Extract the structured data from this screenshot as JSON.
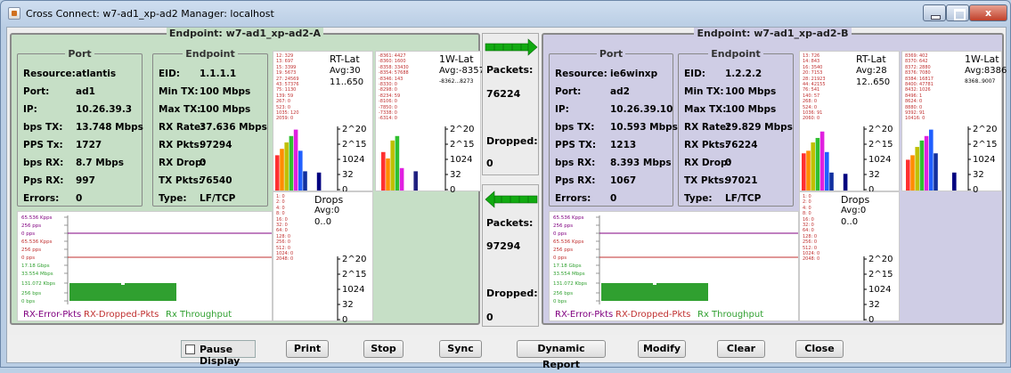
{
  "window": {
    "title": "Cross Connect: w7-ad1_xp-ad2  Manager: localhost",
    "controls": {
      "minimize": "",
      "maximize": "",
      "close": "x"
    }
  },
  "endpoint_a": {
    "title": "Endpoint: w7-ad1_xp-ad2-A",
    "port_box": {
      "title": "Port",
      "rows": [
        {
          "label": "Resource:",
          "value": "atlantis"
        },
        {
          "label": "Port:",
          "value": "ad1"
        },
        {
          "label": "IP:",
          "value": "10.26.39.3"
        },
        {
          "label": "bps TX:",
          "value": "13.748 Mbps"
        },
        {
          "label": "PPS Tx:",
          "value": "1727"
        },
        {
          "label": "bps RX:",
          "value": "8.7 Mbps"
        },
        {
          "label": "Pps RX:",
          "value": "997"
        },
        {
          "label": "Errors:",
          "value": "0"
        }
      ]
    },
    "endpoint_box": {
      "title": "Endpoint",
      "rows": [
        {
          "label": "EID:",
          "value": "1.1.1.1"
        },
        {
          "label": "Min TX:",
          "value": "100 Mbps"
        },
        {
          "label": "Max TX:",
          "value": "100 Mbps"
        },
        {
          "label": "RX Rate:",
          "value": "37.636 Mbps"
        },
        {
          "label": "RX Pkts:",
          "value": "97294"
        },
        {
          "label": "RX Drop:",
          "value": "0"
        },
        {
          "label": "TX Pkts:",
          "value": "76540"
        },
        {
          "label": "Type:",
          "value": "LF/TCP"
        }
      ]
    },
    "rt_lat": {
      "title": "RT-Lat",
      "avg": "Avg:30",
      "range": "11..650",
      "buckets": "12: 329\n13: 697\n15: 3399\n19: 5673\n27: 24569\n43: 57376\n75: 1130\n139: 59\n267: 0\n523: 0\n1035: 120\n2059: 0",
      "yticks": [
        "2^20",
        "2^15",
        "1024",
        "32",
        "0"
      ],
      "bars": [
        0.55,
        0.65,
        0.75,
        0.85,
        0.95,
        0.62,
        0.3,
        0.0,
        0.0,
        0.28,
        0.0
      ],
      "colors": [
        "#ff3030",
        "#ff8c00",
        "#c0c000",
        "#30c030",
        "#e020e0",
        "#2060ff",
        "#1030a0",
        "#606060",
        "#ff4040",
        "#000080",
        "#000080"
      ]
    },
    "ow_lat": {
      "title": "1W-Lat",
      "avg": "Avg:-8357",
      "range": "-8362...8273",
      "buckets": "-8361: 4427\n-8360: 1600\n-8358: 33430\n-8354: 57688\n-8346: 143\n-8330: 0\n-8298: 0\n-8234: 59\n-8106: 0\n-7850: 0\n-7338: 0\n-6314: 0",
      "yticks": [
        "2^20",
        "2^15",
        "1024",
        "32",
        "0"
      ],
      "bars": [
        0.6,
        0.5,
        0.78,
        0.85,
        0.35,
        0.0,
        0.0,
        0.3,
        0.0,
        0.0,
        0.0
      ],
      "colors": [
        "#ff3030",
        "#ff8c00",
        "#c0c000",
        "#30c030",
        "#e020e0",
        "#2060ff",
        "#1030a0",
        "#202080",
        "#000080",
        "#000080",
        "#000080"
      ]
    },
    "drops": {
      "title": "Drops",
      "avg": "Avg:0",
      "range": "0..0",
      "buckets": "1: 0\n2: 0\n4: 0\n8: 0\n16: 0\n32: 0\n64: 0\n128: 0\n256: 0\n512: 0\n1024: 0\n2048: 0",
      "yticks": [
        "2^20",
        "2^15",
        "1024",
        "32",
        "0"
      ]
    },
    "throughput": {
      "ylabels": [
        "65.536 Kpps",
        "256 pps",
        "0 pps",
        "65.536 Kpps",
        "256 pps",
        "0 pps",
        "17.18 Gbps",
        "33.554 Mbps",
        "131.072 Kbps",
        "256 bps",
        "0 bps"
      ],
      "legend": [
        "RX-Error-Pkts",
        "RX-Dropped-Pkts",
        "Rx Throughput"
      ],
      "legend_colors": [
        "#800080",
        "#c03030",
        "#30a030"
      ]
    }
  },
  "endpoint_b": {
    "title": "Endpoint: w7-ad1_xp-ad2-B",
    "port_box": {
      "title": "Port",
      "rows": [
        {
          "label": "Resource:",
          "value": "ie6winxp"
        },
        {
          "label": "Port:",
          "value": "ad2"
        },
        {
          "label": "IP:",
          "value": "10.26.39.10"
        },
        {
          "label": "bps TX:",
          "value": "10.593 Mbps"
        },
        {
          "label": "PPS TX:",
          "value": "1213"
        },
        {
          "label": "bps RX:",
          "value": "8.393 Mbps"
        },
        {
          "label": "Pps RX:",
          "value": "1067"
        },
        {
          "label": "Errors:",
          "value": "0"
        }
      ]
    },
    "endpoint_box": {
      "title": "Endpoint",
      "rows": [
        {
          "label": "EID:",
          "value": "1.2.2.2"
        },
        {
          "label": "Min TX:",
          "value": "100 Mbps"
        },
        {
          "label": "Max TX:",
          "value": "100 Mbps"
        },
        {
          "label": "RX Rate:",
          "value": "29.829 Mbps"
        },
        {
          "label": "RX Pkts:",
          "value": "76224"
        },
        {
          "label": "RX Drop:",
          "value": "0"
        },
        {
          "label": "TX Pkts:",
          "value": "97021"
        },
        {
          "label": "Type:",
          "value": "LF/TCP"
        }
      ]
    },
    "rt_lat": {
      "title": "RT-Lat",
      "avg": "Avg:28",
      "range": "12..650",
      "buckets": "13: 726\n14: 843\n16: 3540\n20: 7153\n28: 21923\n44: 42155\n76: 541\n140: 57\n268: 0\n524: 0\n1036: 91\n2060: 0",
      "yticks": [
        "2^20",
        "2^15",
        "1024",
        "32",
        "0"
      ],
      "bars": [
        0.58,
        0.62,
        0.75,
        0.82,
        0.92,
        0.6,
        0.28,
        0.0,
        0.0,
        0.26,
        0.0
      ],
      "colors": [
        "#ff3030",
        "#ff8c00",
        "#c0c000",
        "#30c030",
        "#e020e0",
        "#2060ff",
        "#1030a0",
        "#606060",
        "#ff4040",
        "#000080",
        "#000080"
      ]
    },
    "ow_lat": {
      "title": "1W-Lat",
      "avg": "Avg:8386",
      "range": "8368..9007",
      "buckets": "8369: 402\n8370: 642\n8372: 2880\n8376: 7080\n8384: 16817\n8400: 47781\n8432: 1026\n8496: 1\n8624: 0\n8880: 0\n9392: 91\n10416: 0",
      "yticks": [
        "2^20",
        "2^15",
        "1024",
        "32",
        "0"
      ],
      "bars": [
        0.48,
        0.55,
        0.68,
        0.78,
        0.85,
        0.95,
        0.58,
        0.0,
        0.0,
        0.0,
        0.28
      ],
      "colors": [
        "#ff3030",
        "#ff8c00",
        "#c0c000",
        "#30c030",
        "#e020e0",
        "#2060ff",
        "#1030a0",
        "#202080",
        "#000080",
        "#000080",
        "#000080"
      ]
    },
    "drops": {
      "title": "Drops",
      "avg": "Avg:0",
      "range": "0..0",
      "buckets": "1: 0\n2: 0\n4: 0\n8: 0\n16: 0\n32: 0\n64: 0\n128: 0\n256: 0\n512: 0\n1024: 0\n2048: 0",
      "yticks": [
        "2^20",
        "2^15",
        "1024",
        "32",
        "0"
      ]
    },
    "throughput": {
      "ylabels": [
        "65.536 Kpps",
        "256 pps",
        "0 pps",
        "65.536 Kpps",
        "256 pps",
        "0 pps",
        "17.18 Gbps",
        "33.554 Mbps",
        "131.072 Kbps",
        "256 bps",
        "0 bps"
      ],
      "legend": [
        "RX-Error-Pkts",
        "RX-Dropped-Pkts",
        "Rx Throughput"
      ],
      "legend_colors": [
        "#800080",
        "#c03030",
        "#30a030"
      ]
    }
  },
  "middle": {
    "top": {
      "packets_label": "Packets:",
      "packets": "76224",
      "dropped_label": "Dropped:",
      "dropped": "0"
    },
    "bottom": {
      "packets_label": "Packets:",
      "packets": "97294",
      "dropped_label": "Dropped:",
      "dropped": "0"
    }
  },
  "buttons": {
    "pause": "Pause Display",
    "print": "Print",
    "stop": "Stop",
    "sync": "Sync",
    "dynamic_report": "Dynamic Report",
    "modify": "Modify",
    "clear": "Clear",
    "close": "Close"
  },
  "colors": {
    "endpoint_a_bg": "#c6dfc6",
    "endpoint_b_bg": "#cfcde5",
    "throughput_fill": "#30a030",
    "arrow": "#11aa11"
  }
}
